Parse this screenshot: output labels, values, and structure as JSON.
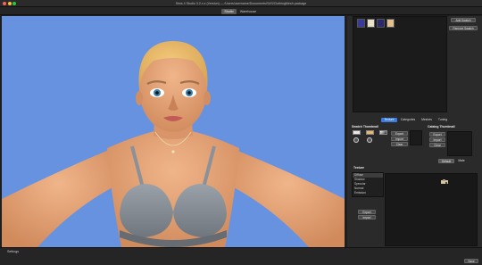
{
  "window": {
    "title": "Sims 4 Studio 3.2.x.x (Version) — /Users/username/Documents/S4S/ClothingMesh.package",
    "traffic_colors": [
      "#fe5f57",
      "#febc2e",
      "#28c840"
    ]
  },
  "mode_tabs": [
    {
      "label": "Studio",
      "active": true
    },
    {
      "label": "Warehouse",
      "active": false
    }
  ],
  "right_panel": {
    "add_swatch_label": "Add Swatch",
    "remove_swatch_label": "Remove Swatch",
    "tabs": [
      "Texture",
      "Categories",
      "Meshes",
      "Tuning"
    ],
    "active_tab": "Texture",
    "swatch_thumbnail": {
      "title": "Swatch Thumbnail",
      "export_label": "Export",
      "import_label": "Import",
      "clear_label": "Clear"
    },
    "catalog_thumbnail": {
      "title": "Catalog Thumbnail",
      "export_label": "Export",
      "import_label": "Import",
      "clear_label": "Clear",
      "mode_options": [
        "Default",
        "Male"
      ]
    },
    "textures": {
      "title": "Texture",
      "items": [
        "Diffuse",
        "Shadow",
        "Specular",
        "Normal",
        "Emission"
      ],
      "export_label": "Export",
      "import_label": "Import"
    }
  },
  "status": {
    "settings_label": "Settings",
    "save_label": "Save"
  },
  "colors": {
    "viewport_bg": "#6792e0",
    "active_tab": "#3b7de0"
  }
}
